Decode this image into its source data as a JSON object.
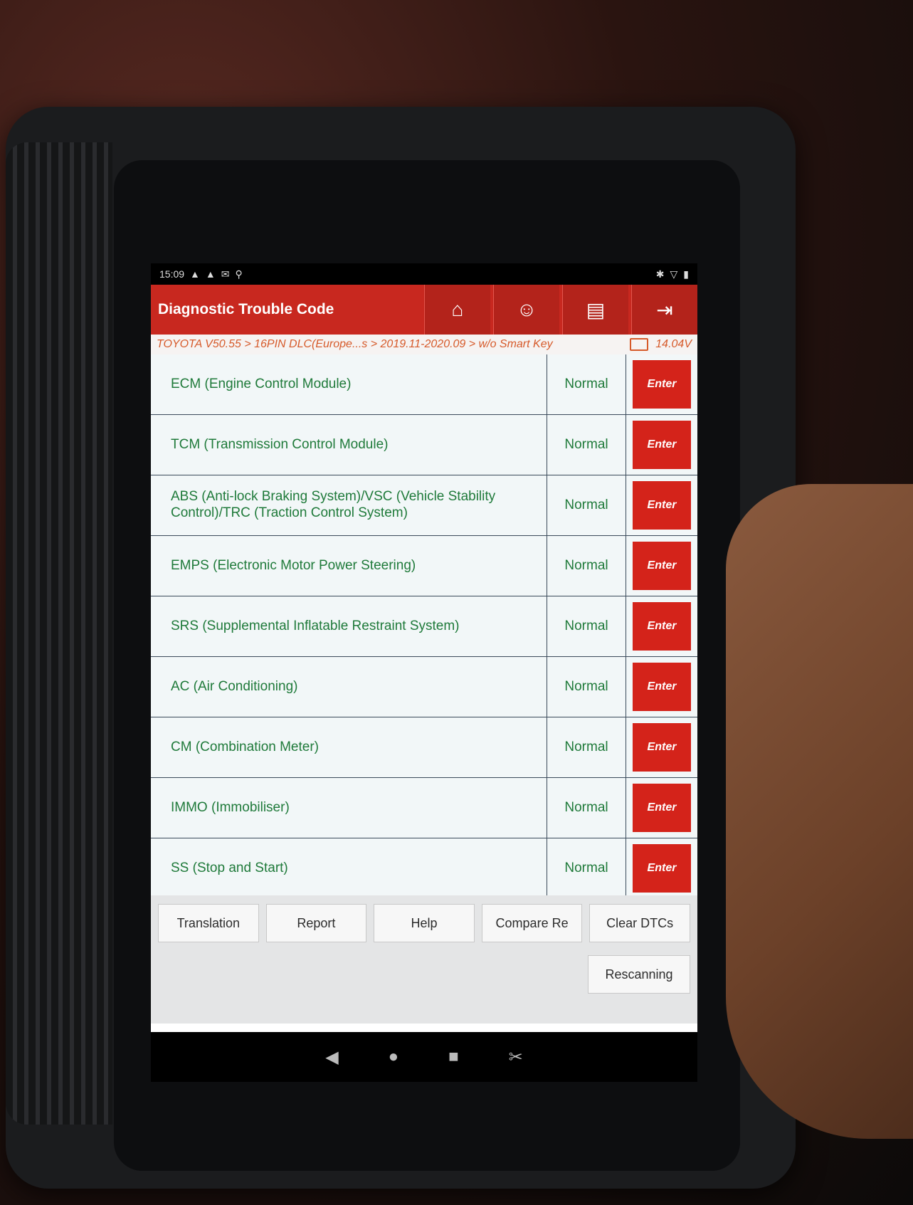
{
  "status_bar": {
    "time": "15:09",
    "left_icons": [
      "warning-icon",
      "warning-icon",
      "message-icon",
      "usb-icon"
    ],
    "right_icons": [
      "bluetooth-icon",
      "wifi-icon",
      "battery-icon"
    ]
  },
  "header": {
    "title": "Diagnostic Trouble Code",
    "icons": [
      "home-icon",
      "support-icon",
      "print-icon",
      "exit-icon"
    ]
  },
  "breadcrumb": {
    "path": "TOYOTA V50.55 > 16PIN DLC(Europe...s > 2019.11-2020.09 > w/o Smart Key",
    "voltage": "14.04V"
  },
  "modules": [
    {
      "name": "ECM (Engine Control Module)",
      "status": "Normal",
      "action": "Enter"
    },
    {
      "name": "TCM (Transmission Control Module)",
      "status": "Normal",
      "action": "Enter"
    },
    {
      "name": "ABS (Anti-lock Braking System)/VSC (Vehicle Stability Control)/TRC (Traction Control System)",
      "status": "Normal",
      "action": "Enter"
    },
    {
      "name": "EMPS (Electronic Motor Power Steering)",
      "status": "Normal",
      "action": "Enter"
    },
    {
      "name": "SRS (Supplemental Inflatable Restraint System)",
      "status": "Normal",
      "action": "Enter"
    },
    {
      "name": "AC (Air Conditioning)",
      "status": "Normal",
      "action": "Enter"
    },
    {
      "name": "CM (Combination Meter)",
      "status": "Normal",
      "action": "Enter"
    },
    {
      "name": "IMMO (Immobiliser)",
      "status": "Normal",
      "action": "Enter"
    },
    {
      "name": "SS (Stop and Start)",
      "status": "Normal",
      "action": "Enter"
    }
  ],
  "footer": {
    "translation": "Translation",
    "report": "Report",
    "help": "Help",
    "compare": "Compare Re",
    "clear_dtcs": "Clear DTCs",
    "rescanning": "Rescanning"
  },
  "navbar": {
    "icons": [
      "back-icon",
      "home-nav-icon",
      "recents-icon",
      "screenshot-icon"
    ]
  },
  "colors": {
    "header_red": "#c8281f",
    "enter_red": "#d4231a",
    "status_green": "#1f7a3a",
    "breadcrumb_orange": "#d65a2a"
  }
}
